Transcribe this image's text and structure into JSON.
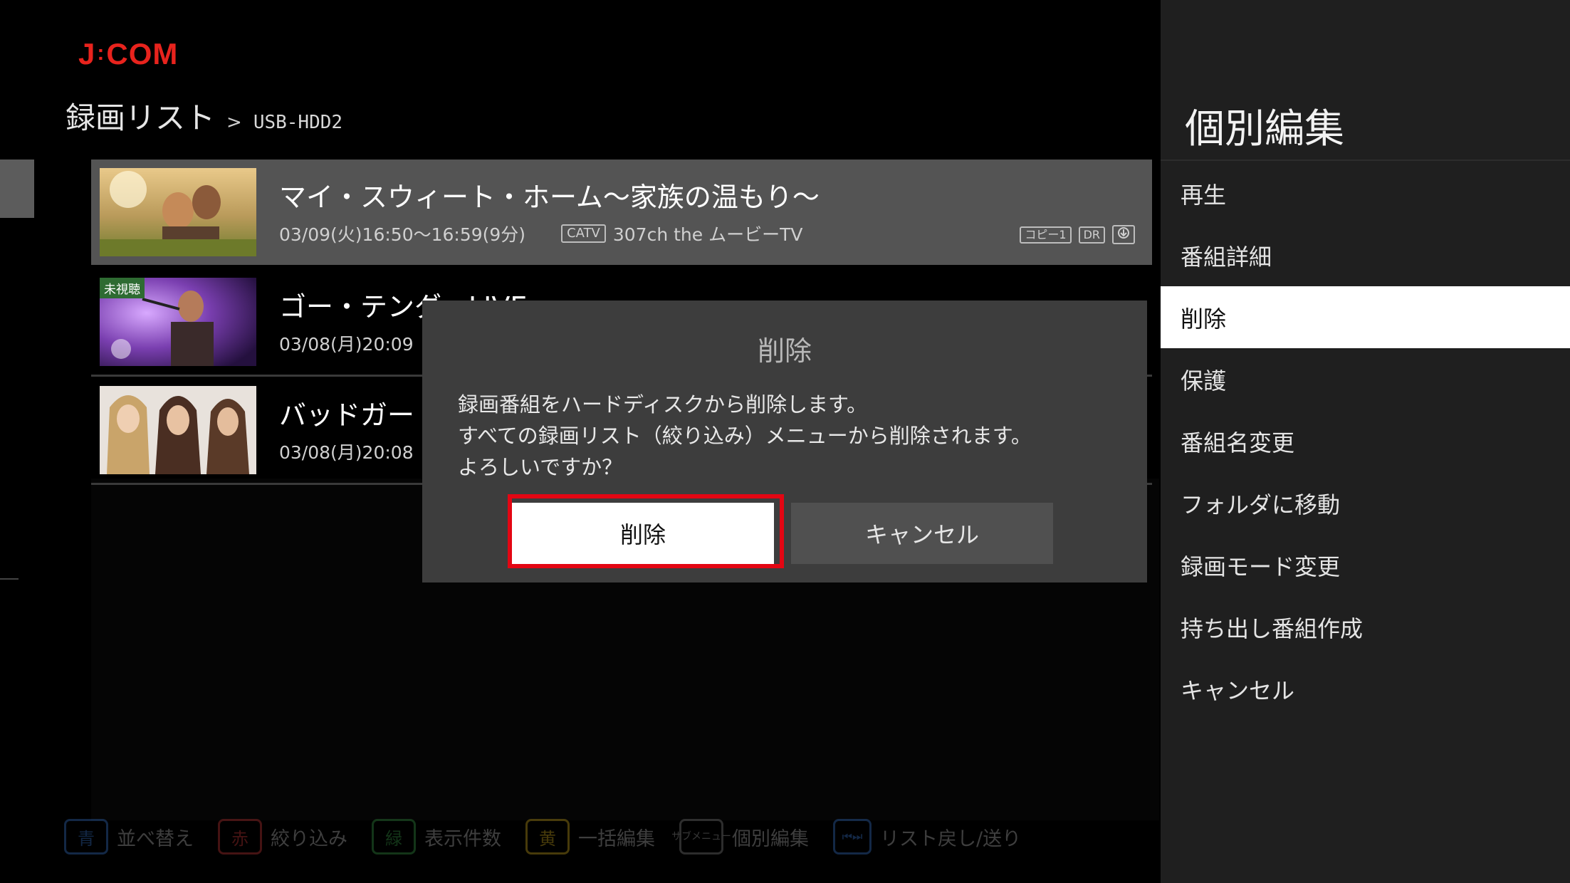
{
  "header": {
    "logo": "J:COM",
    "breadcrumb_title": "録画リスト",
    "breadcrumb_sep": ">",
    "device": "USB-HDD2"
  },
  "recordings": [
    {
      "title": "マイ・スウィート・ホーム〜家族の温もり〜",
      "datetime": "03/09(火)16:50〜16:59(9分)",
      "tag": "CATV",
      "channel": "307ch the ムービーTV",
      "badges": [
        "コピー1",
        "DR"
      ],
      "thumb_icon": "family-photo-icon"
    },
    {
      "title": "ゴー・テンダーLIVE",
      "datetime": "03/08(月)20:09",
      "unwatched_label": "未視聴",
      "thumb_icon": "singer-photo-icon"
    },
    {
      "title": "バッドガー",
      "datetime": "03/08(月)20:08",
      "thumb_icon": "women-photo-icon"
    }
  ],
  "dialog": {
    "title": "削除",
    "message_lines": [
      "録画番組をハードディスクから削除します。",
      "すべての録画リスト（絞り込み）メニューから削除されます。",
      "よろしいですか？"
    ],
    "confirm_label": "削除",
    "cancel_label": "キャンセル"
  },
  "side_menu": {
    "title": "個別編集",
    "items": [
      {
        "label": "再生"
      },
      {
        "label": "番組詳細"
      },
      {
        "label": "削除",
        "active": true
      },
      {
        "label": "保護"
      },
      {
        "label": "番組名変更"
      },
      {
        "label": "フォルダに移動"
      },
      {
        "label": "録画モード変更"
      },
      {
        "label": "持ち出し番組作成"
      },
      {
        "label": "キャンセル"
      }
    ]
  },
  "hints": [
    {
      "key": "青",
      "label": "並べ替え",
      "color": "#3a7bd5"
    },
    {
      "key": "赤",
      "label": "絞り込み",
      "color": "#d03a3a"
    },
    {
      "key": "緑",
      "label": "表示件数",
      "color": "#3aa04a"
    },
    {
      "key": "黄",
      "label": "一括編集",
      "color": "#d6b020"
    },
    {
      "key": "サブメニュー",
      "label": "個別編集"
    },
    {
      "key": "⏮⏭",
      "label": "リスト戻し/送り"
    }
  ],
  "colors": {
    "brand": "#e8231d",
    "selection_frame": "#e30613"
  }
}
